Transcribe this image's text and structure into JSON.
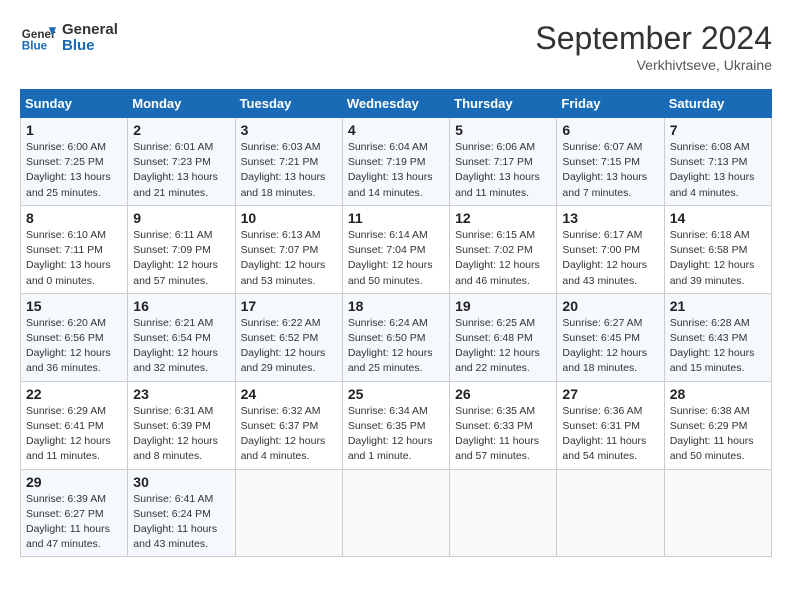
{
  "header": {
    "logo_line1": "General",
    "logo_line2": "Blue",
    "month": "September 2024",
    "location": "Verkhivtseve, Ukraine"
  },
  "weekdays": [
    "Sunday",
    "Monday",
    "Tuesday",
    "Wednesday",
    "Thursday",
    "Friday",
    "Saturday"
  ],
  "weeks": [
    [
      {
        "day": "1",
        "sunrise": "Sunrise: 6:00 AM",
        "sunset": "Sunset: 7:25 PM",
        "daylight": "Daylight: 13 hours and 25 minutes."
      },
      {
        "day": "2",
        "sunrise": "Sunrise: 6:01 AM",
        "sunset": "Sunset: 7:23 PM",
        "daylight": "Daylight: 13 hours and 21 minutes."
      },
      {
        "day": "3",
        "sunrise": "Sunrise: 6:03 AM",
        "sunset": "Sunset: 7:21 PM",
        "daylight": "Daylight: 13 hours and 18 minutes."
      },
      {
        "day": "4",
        "sunrise": "Sunrise: 6:04 AM",
        "sunset": "Sunset: 7:19 PM",
        "daylight": "Daylight: 13 hours and 14 minutes."
      },
      {
        "day": "5",
        "sunrise": "Sunrise: 6:06 AM",
        "sunset": "Sunset: 7:17 PM",
        "daylight": "Daylight: 13 hours and 11 minutes."
      },
      {
        "day": "6",
        "sunrise": "Sunrise: 6:07 AM",
        "sunset": "Sunset: 7:15 PM",
        "daylight": "Daylight: 13 hours and 7 minutes."
      },
      {
        "day": "7",
        "sunrise": "Sunrise: 6:08 AM",
        "sunset": "Sunset: 7:13 PM",
        "daylight": "Daylight: 13 hours and 4 minutes."
      }
    ],
    [
      {
        "day": "8",
        "sunrise": "Sunrise: 6:10 AM",
        "sunset": "Sunset: 7:11 PM",
        "daylight": "Daylight: 13 hours and 0 minutes."
      },
      {
        "day": "9",
        "sunrise": "Sunrise: 6:11 AM",
        "sunset": "Sunset: 7:09 PM",
        "daylight": "Daylight: 12 hours and 57 minutes."
      },
      {
        "day": "10",
        "sunrise": "Sunrise: 6:13 AM",
        "sunset": "Sunset: 7:07 PM",
        "daylight": "Daylight: 12 hours and 53 minutes."
      },
      {
        "day": "11",
        "sunrise": "Sunrise: 6:14 AM",
        "sunset": "Sunset: 7:04 PM",
        "daylight": "Daylight: 12 hours and 50 minutes."
      },
      {
        "day": "12",
        "sunrise": "Sunrise: 6:15 AM",
        "sunset": "Sunset: 7:02 PM",
        "daylight": "Daylight: 12 hours and 46 minutes."
      },
      {
        "day": "13",
        "sunrise": "Sunrise: 6:17 AM",
        "sunset": "Sunset: 7:00 PM",
        "daylight": "Daylight: 12 hours and 43 minutes."
      },
      {
        "day": "14",
        "sunrise": "Sunrise: 6:18 AM",
        "sunset": "Sunset: 6:58 PM",
        "daylight": "Daylight: 12 hours and 39 minutes."
      }
    ],
    [
      {
        "day": "15",
        "sunrise": "Sunrise: 6:20 AM",
        "sunset": "Sunset: 6:56 PM",
        "daylight": "Daylight: 12 hours and 36 minutes."
      },
      {
        "day": "16",
        "sunrise": "Sunrise: 6:21 AM",
        "sunset": "Sunset: 6:54 PM",
        "daylight": "Daylight: 12 hours and 32 minutes."
      },
      {
        "day": "17",
        "sunrise": "Sunrise: 6:22 AM",
        "sunset": "Sunset: 6:52 PM",
        "daylight": "Daylight: 12 hours and 29 minutes."
      },
      {
        "day": "18",
        "sunrise": "Sunrise: 6:24 AM",
        "sunset": "Sunset: 6:50 PM",
        "daylight": "Daylight: 12 hours and 25 minutes."
      },
      {
        "day": "19",
        "sunrise": "Sunrise: 6:25 AM",
        "sunset": "Sunset: 6:48 PM",
        "daylight": "Daylight: 12 hours and 22 minutes."
      },
      {
        "day": "20",
        "sunrise": "Sunrise: 6:27 AM",
        "sunset": "Sunset: 6:45 PM",
        "daylight": "Daylight: 12 hours and 18 minutes."
      },
      {
        "day": "21",
        "sunrise": "Sunrise: 6:28 AM",
        "sunset": "Sunset: 6:43 PM",
        "daylight": "Daylight: 12 hours and 15 minutes."
      }
    ],
    [
      {
        "day": "22",
        "sunrise": "Sunrise: 6:29 AM",
        "sunset": "Sunset: 6:41 PM",
        "daylight": "Daylight: 12 hours and 11 minutes."
      },
      {
        "day": "23",
        "sunrise": "Sunrise: 6:31 AM",
        "sunset": "Sunset: 6:39 PM",
        "daylight": "Daylight: 12 hours and 8 minutes."
      },
      {
        "day": "24",
        "sunrise": "Sunrise: 6:32 AM",
        "sunset": "Sunset: 6:37 PM",
        "daylight": "Daylight: 12 hours and 4 minutes."
      },
      {
        "day": "25",
        "sunrise": "Sunrise: 6:34 AM",
        "sunset": "Sunset: 6:35 PM",
        "daylight": "Daylight: 12 hours and 1 minute."
      },
      {
        "day": "26",
        "sunrise": "Sunrise: 6:35 AM",
        "sunset": "Sunset: 6:33 PM",
        "daylight": "Daylight: 11 hours and 57 minutes."
      },
      {
        "day": "27",
        "sunrise": "Sunrise: 6:36 AM",
        "sunset": "Sunset: 6:31 PM",
        "daylight": "Daylight: 11 hours and 54 minutes."
      },
      {
        "day": "28",
        "sunrise": "Sunrise: 6:38 AM",
        "sunset": "Sunset: 6:29 PM",
        "daylight": "Daylight: 11 hours and 50 minutes."
      }
    ],
    [
      {
        "day": "29",
        "sunrise": "Sunrise: 6:39 AM",
        "sunset": "Sunset: 6:27 PM",
        "daylight": "Daylight: 11 hours and 47 minutes."
      },
      {
        "day": "30",
        "sunrise": "Sunrise: 6:41 AM",
        "sunset": "Sunset: 6:24 PM",
        "daylight": "Daylight: 11 hours and 43 minutes."
      },
      null,
      null,
      null,
      null,
      null
    ]
  ]
}
